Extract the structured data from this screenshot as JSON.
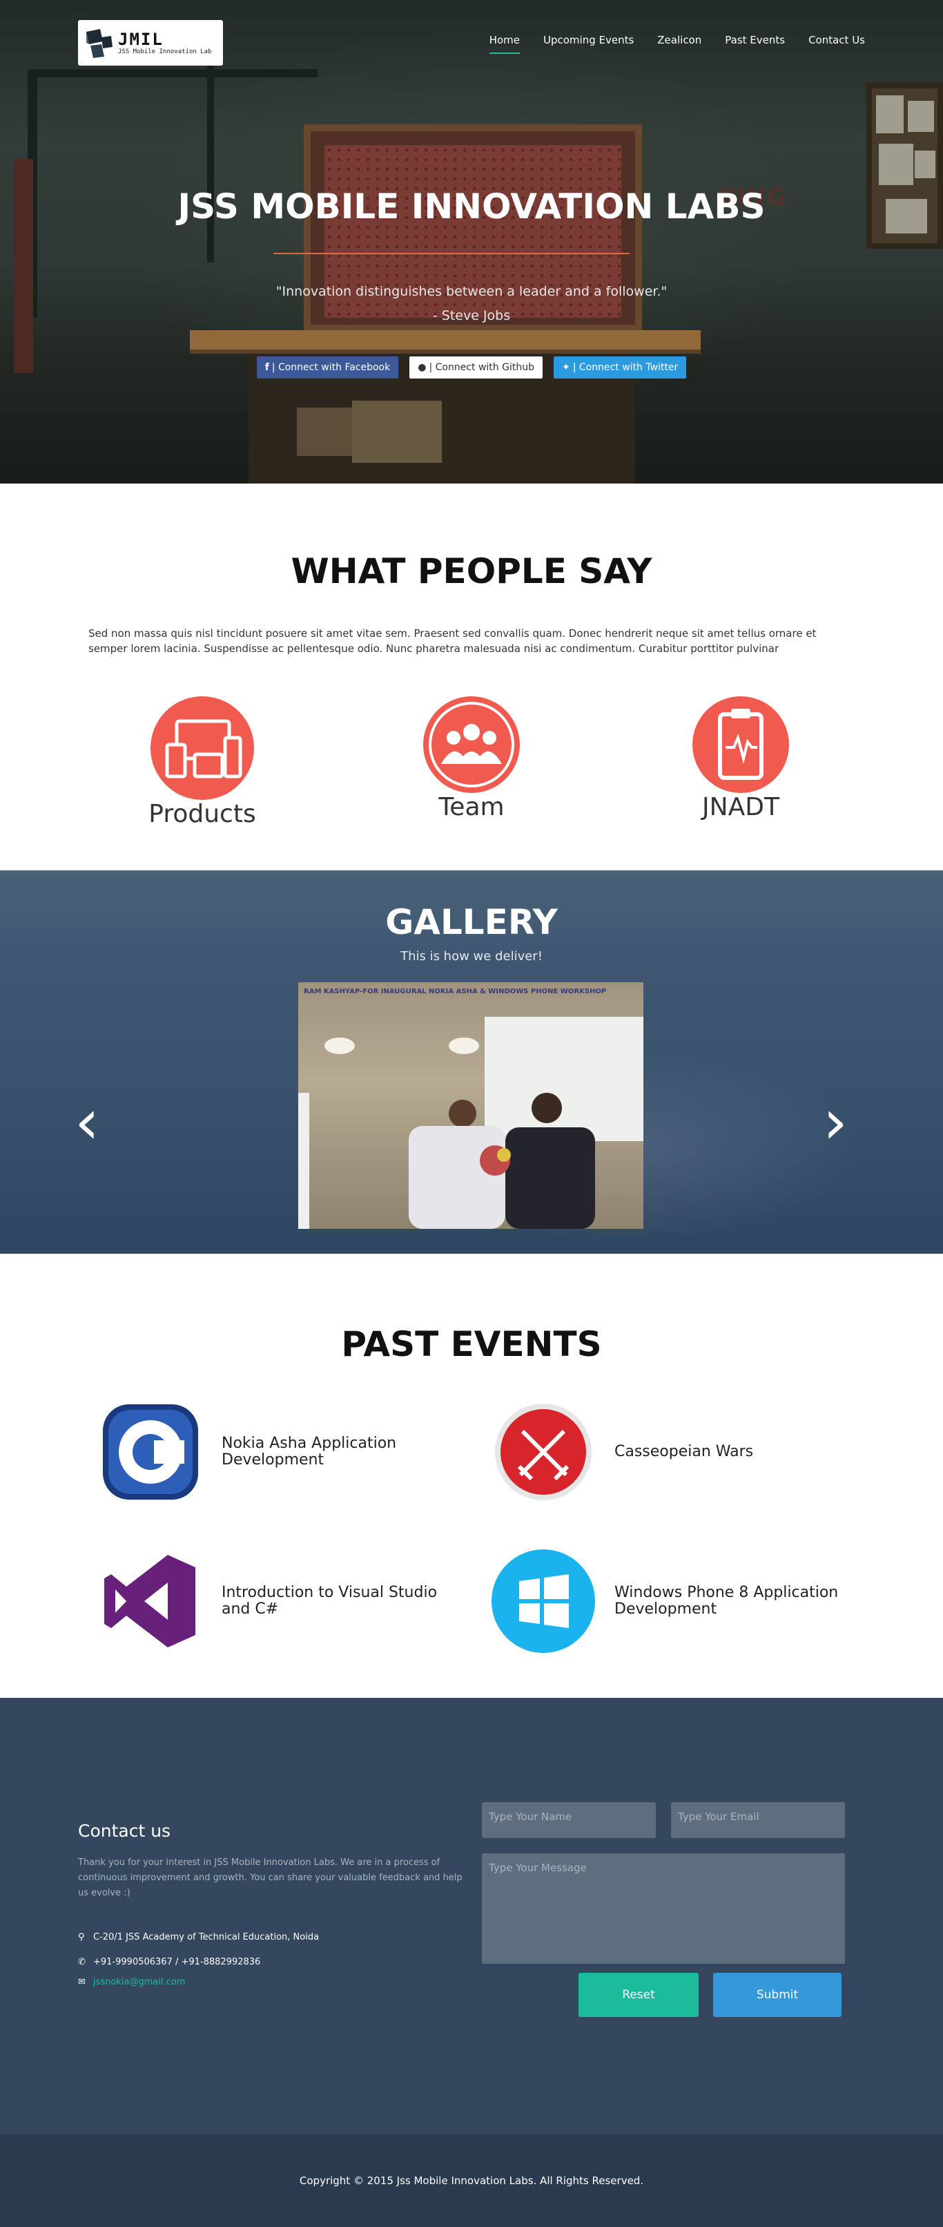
{
  "logo": {
    "title": "JMIL",
    "subtitle": "JSS Mobile Innovation Lab"
  },
  "nav": [
    {
      "label": "Home",
      "active": true
    },
    {
      "label": "Upcoming Events",
      "active": false
    },
    {
      "label": "Zealicon",
      "active": false
    },
    {
      "label": "Past Events",
      "active": false
    },
    {
      "label": "Contact Us",
      "active": false
    }
  ],
  "hero": {
    "title": "JSS MOBILE INNOVATION LABS",
    "quote": "\"Innovation distinguishes between a leader and a follower.\"",
    "author": "- Steve Jobs",
    "buttons": {
      "facebook": "| Connect with Facebook",
      "github": "| Connect with Github",
      "twitter": "| Connect with Twitter"
    },
    "backdrop_sign": "KING"
  },
  "wps": {
    "title": "WHAT PEOPLE SAY",
    "text": "Sed non massa quis nisl tincidunt posuere sit amet vitae sem. Praesent sed convallis quam. Donec hendrerit neque sit amet tellus ornare et semper lorem lacinia. Suspendisse ac pellentesque odio. Nunc pharetra malesuada nisi ac condimentum. Curabitur porttitor pulvinar",
    "features": [
      {
        "label": "Products",
        "icon": "devices-icon"
      },
      {
        "label": "Team",
        "icon": "team-icon"
      },
      {
        "label": "JNADT",
        "icon": "clipboard-pulse-icon"
      }
    ]
  },
  "gallery": {
    "title": "GALLERY",
    "subtitle": "This is how we deliver!",
    "caption": "RAM KASHYAP-FOR INAUGURAL NOKIA ASHA & WINDOWS PHONE WORKSHOP"
  },
  "past": {
    "title": "PAST EVENTS",
    "events": [
      {
        "name": "Nokia Asha Application Development",
        "icon": "nokia-asha-icon"
      },
      {
        "name": "Casseopeian Wars",
        "icon": "crossed-swords-icon"
      },
      {
        "name": "Introduction to Visual Studio and C#",
        "icon": "visual-studio-icon"
      },
      {
        "name": "Windows Phone 8 Application Development",
        "icon": "windows-logo-icon"
      }
    ]
  },
  "contact": {
    "title": "Contact us",
    "text": "Thank you for your interest in JSS Mobile Innovation Labs. We are in a process of continuous improvement and growth. You can share your valuable feedback and help us evolve :)",
    "address": "C-20/1 JSS Academy of Technical Education, Noida",
    "phone": "+91-9990506367 / +91-8882992836",
    "email": "jssnokia@gmail.com",
    "form": {
      "name_placeholder": "Type Your Name",
      "email_placeholder": "Type Your Email",
      "message_placeholder": "Type Your Message",
      "reset": "Reset",
      "submit": "Submit"
    },
    "colors": {
      "reset": "#1abc9c",
      "submit": "#3498db"
    }
  },
  "footer": {
    "text": "Copyright © 2015 Jss Mobile Innovation Labs. All Rights Reserved."
  }
}
